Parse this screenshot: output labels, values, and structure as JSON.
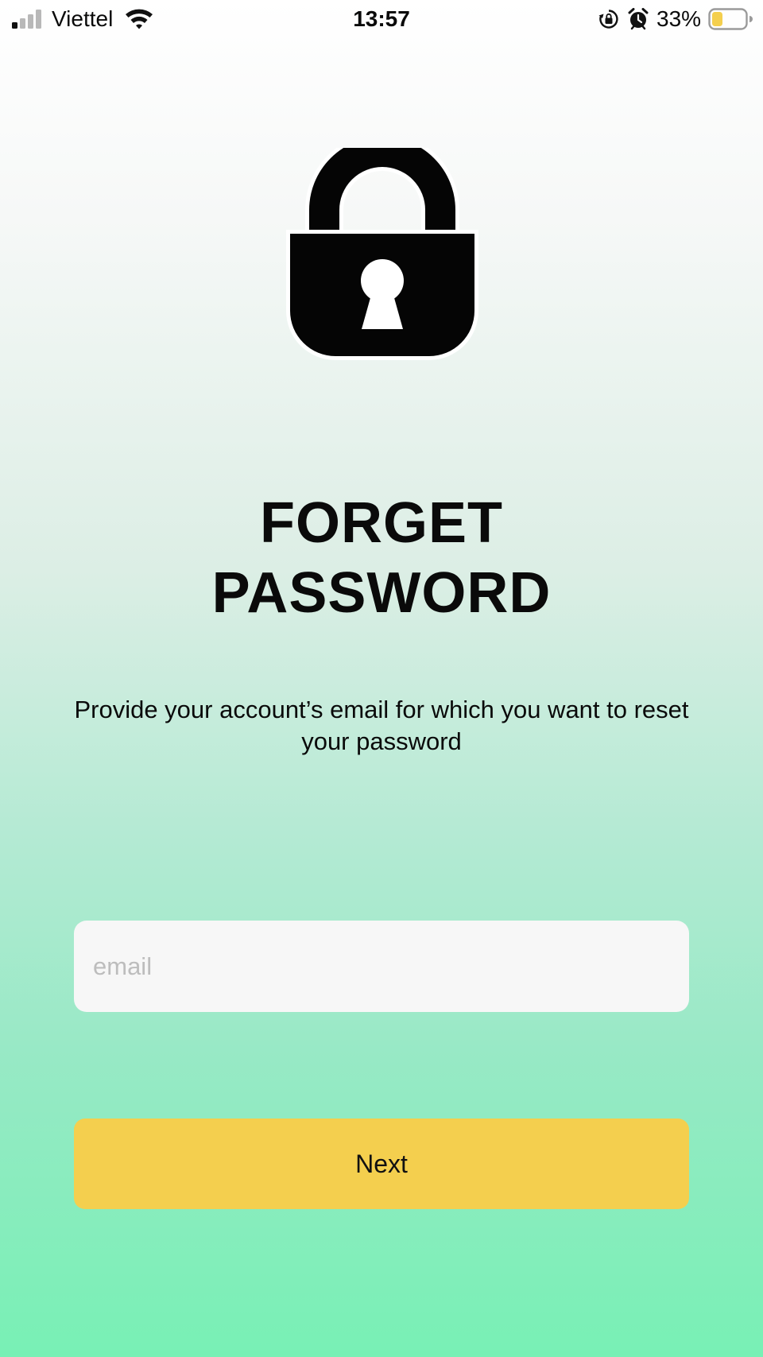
{
  "status_bar": {
    "carrier": "Viettel",
    "time": "13:57",
    "battery_percent": "33%",
    "signal_bars_active": 1,
    "signal_bars_total": 4,
    "battery_level": 0.33,
    "battery_color": "#f4cf4e",
    "icons": [
      "signal-icon",
      "wifi-icon",
      "orientation-lock-icon",
      "alarm-icon",
      "battery-icon"
    ]
  },
  "hero": {
    "icon": "padlock-icon",
    "title_line1": "FORGET",
    "title_line2": "PASSWORD",
    "subtitle": "Provide your account’s email for which you want to reset your password"
  },
  "form": {
    "email_placeholder": "email",
    "email_value": "",
    "next_label": "Next"
  },
  "colors": {
    "accent": "#f4cf4e",
    "gradient_top": "#ffffff",
    "gradient_bottom": "#78f0b5",
    "input_background": "#f7f7f7"
  }
}
